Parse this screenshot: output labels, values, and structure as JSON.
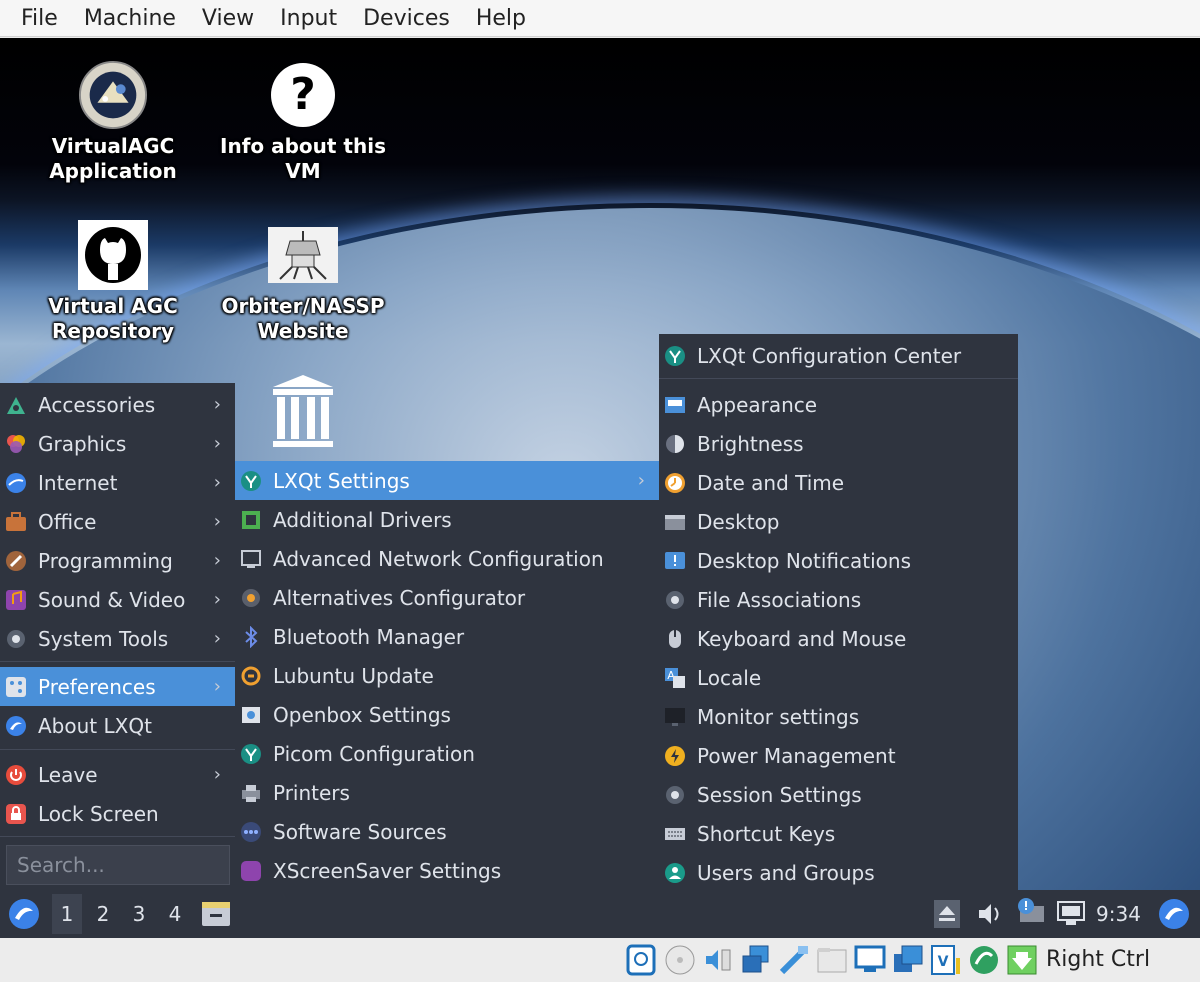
{
  "host_menubar": [
    "File",
    "Machine",
    "View",
    "Input",
    "Devices",
    "Help"
  ],
  "desktop_icons": [
    {
      "label_line1": "VirtualAGC",
      "label_line2": "Application",
      "icon": "apollo-nasa-icon"
    },
    {
      "label_line1": "Info about this",
      "label_line2": "VM",
      "icon": "question-mark-icon"
    },
    {
      "label_line1": "Virtual AGC",
      "label_line2": "Repository",
      "icon": "github-icon"
    },
    {
      "label_line1": "Orbiter/NASSP",
      "label_line2": "Website",
      "icon": "lunar-module-icon"
    },
    {
      "label_line1": "",
      "label_line2": "",
      "icon": "archive-building-icon"
    }
  ],
  "main_menu": {
    "items": [
      {
        "label": "Accessories",
        "icon": "accessories-icon",
        "submenu": true
      },
      {
        "label": "Graphics",
        "icon": "graphics-icon",
        "submenu": true
      },
      {
        "label": "Internet",
        "icon": "internet-icon",
        "submenu": true
      },
      {
        "label": "Office",
        "icon": "office-icon",
        "submenu": true
      },
      {
        "label": "Programming",
        "icon": "programming-icon",
        "submenu": true
      },
      {
        "label": "Sound & Video",
        "icon": "sound-video-icon",
        "submenu": true
      },
      {
        "label": "System Tools",
        "icon": "system-tools-icon",
        "submenu": true
      },
      {
        "label": "Preferences",
        "icon": "preferences-icon",
        "submenu": true,
        "selected": true
      },
      {
        "label": "About LXQt",
        "icon": "lxqt-icon",
        "submenu": false
      },
      {
        "label": "Leave",
        "icon": "power-icon",
        "submenu": true
      },
      {
        "label": "Lock Screen",
        "icon": "lock-icon",
        "submenu": false
      }
    ],
    "search_placeholder": "Search..."
  },
  "preferences_menu": {
    "items": [
      {
        "label": "LXQt Settings",
        "icon": "lxqt-settings-icon",
        "submenu": true,
        "selected": true
      },
      {
        "label": "Additional Drivers",
        "icon": "chip-icon"
      },
      {
        "label": "Advanced Network Configuration",
        "icon": "network-icon"
      },
      {
        "label": "Alternatives Configurator",
        "icon": "alternatives-icon"
      },
      {
        "label": "Bluetooth Manager",
        "icon": "bluetooth-icon"
      },
      {
        "label": "Lubuntu Update",
        "icon": "update-icon"
      },
      {
        "label": "Openbox Settings",
        "icon": "openbox-icon"
      },
      {
        "label": "Picom Configuration",
        "icon": "picom-icon"
      },
      {
        "label": "Printers",
        "icon": "printer-icon"
      },
      {
        "label": "Software Sources",
        "icon": "software-sources-icon"
      },
      {
        "label": "XScreenSaver Settings",
        "icon": "screensaver-icon"
      }
    ]
  },
  "lxqt_settings_menu": {
    "items": [
      {
        "label": "LXQt Configuration Center",
        "icon": "lxqt-settings-icon"
      },
      {
        "label": "Appearance",
        "icon": "appearance-icon"
      },
      {
        "label": "Brightness",
        "icon": "brightness-icon"
      },
      {
        "label": "Date and Time",
        "icon": "clock-icon"
      },
      {
        "label": "Desktop",
        "icon": "desktop-icon"
      },
      {
        "label": "Desktop Notifications",
        "icon": "notification-icon"
      },
      {
        "label": "File Associations",
        "icon": "gear-icon"
      },
      {
        "label": "Keyboard and Mouse",
        "icon": "mouse-icon"
      },
      {
        "label": "Locale",
        "icon": "locale-icon"
      },
      {
        "label": "Monitor settings",
        "icon": "monitor-icon"
      },
      {
        "label": "Power Management",
        "icon": "power-management-icon"
      },
      {
        "label": "Session Settings",
        "icon": "gear-icon"
      },
      {
        "label": "Shortcut Keys",
        "icon": "keyboard-icon"
      },
      {
        "label": "Users and Groups",
        "icon": "users-icon"
      }
    ]
  },
  "panel": {
    "workspaces": [
      "1",
      "2",
      "3",
      "4"
    ],
    "active_workspace": "1",
    "clock": "9:34"
  },
  "host_status": {
    "host_key": "Right Ctrl"
  },
  "colors": {
    "menu_bg": "#2f343f",
    "highlight": "#4a90d9",
    "text": "#dfe3ea"
  }
}
